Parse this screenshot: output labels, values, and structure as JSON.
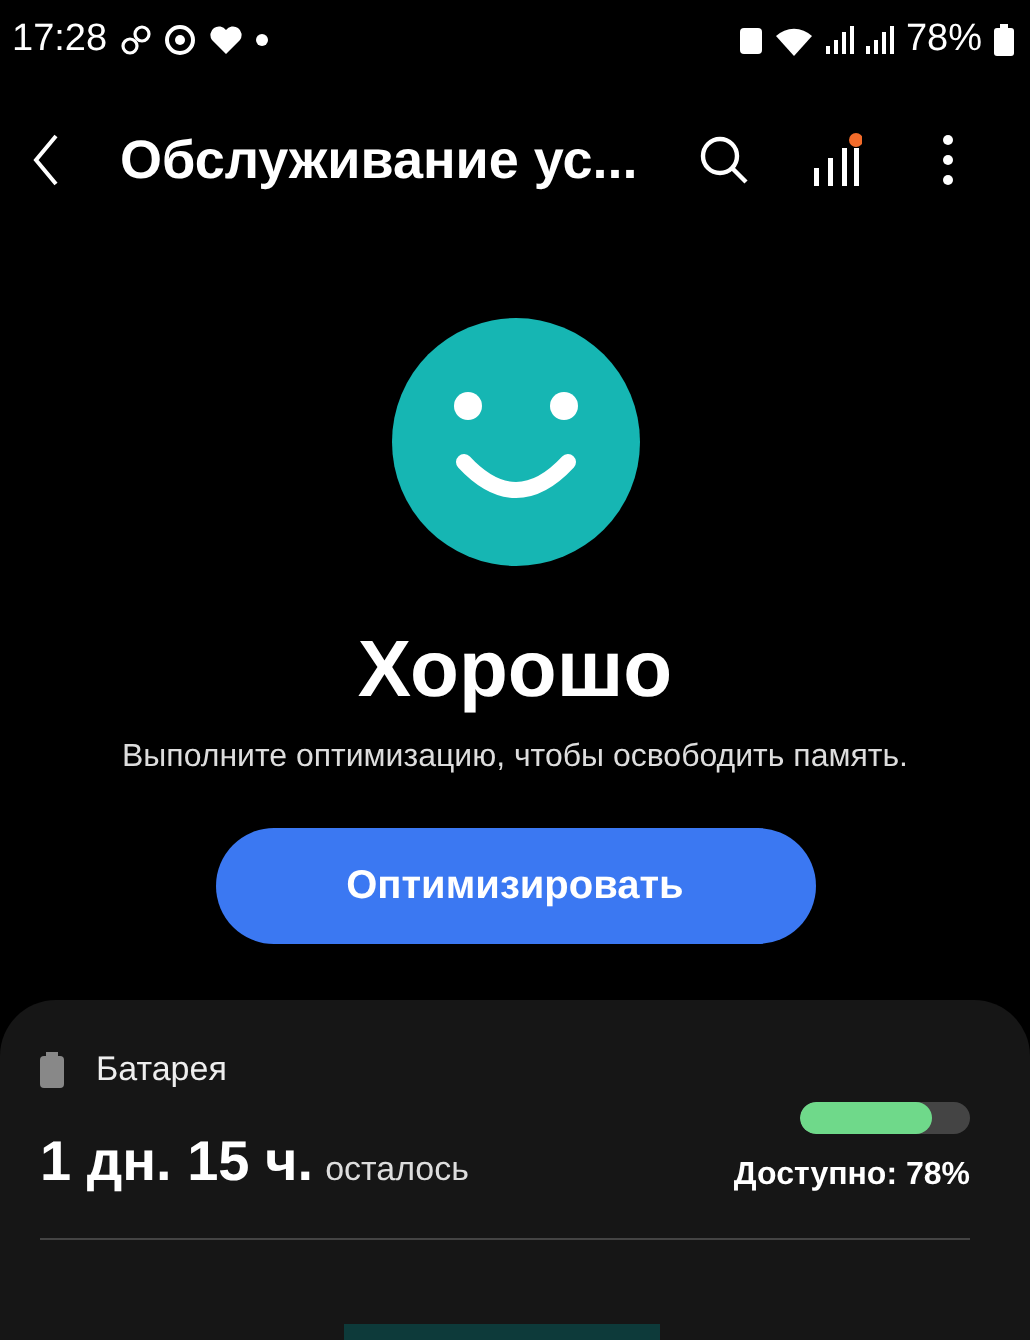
{
  "status_bar": {
    "time": "17:28",
    "battery": "78%"
  },
  "header": {
    "title": "Обслуживание ус..."
  },
  "status": {
    "title": "Хорошо",
    "message": "Выполните оптимизацию, чтобы освободить память.",
    "button": "Оптимизировать"
  },
  "battery_card": {
    "label": "Батарея",
    "time_left": "1 дн. 15 ч.",
    "suffix": "осталось",
    "level": 0.78,
    "available": "Доступно: 78%"
  }
}
